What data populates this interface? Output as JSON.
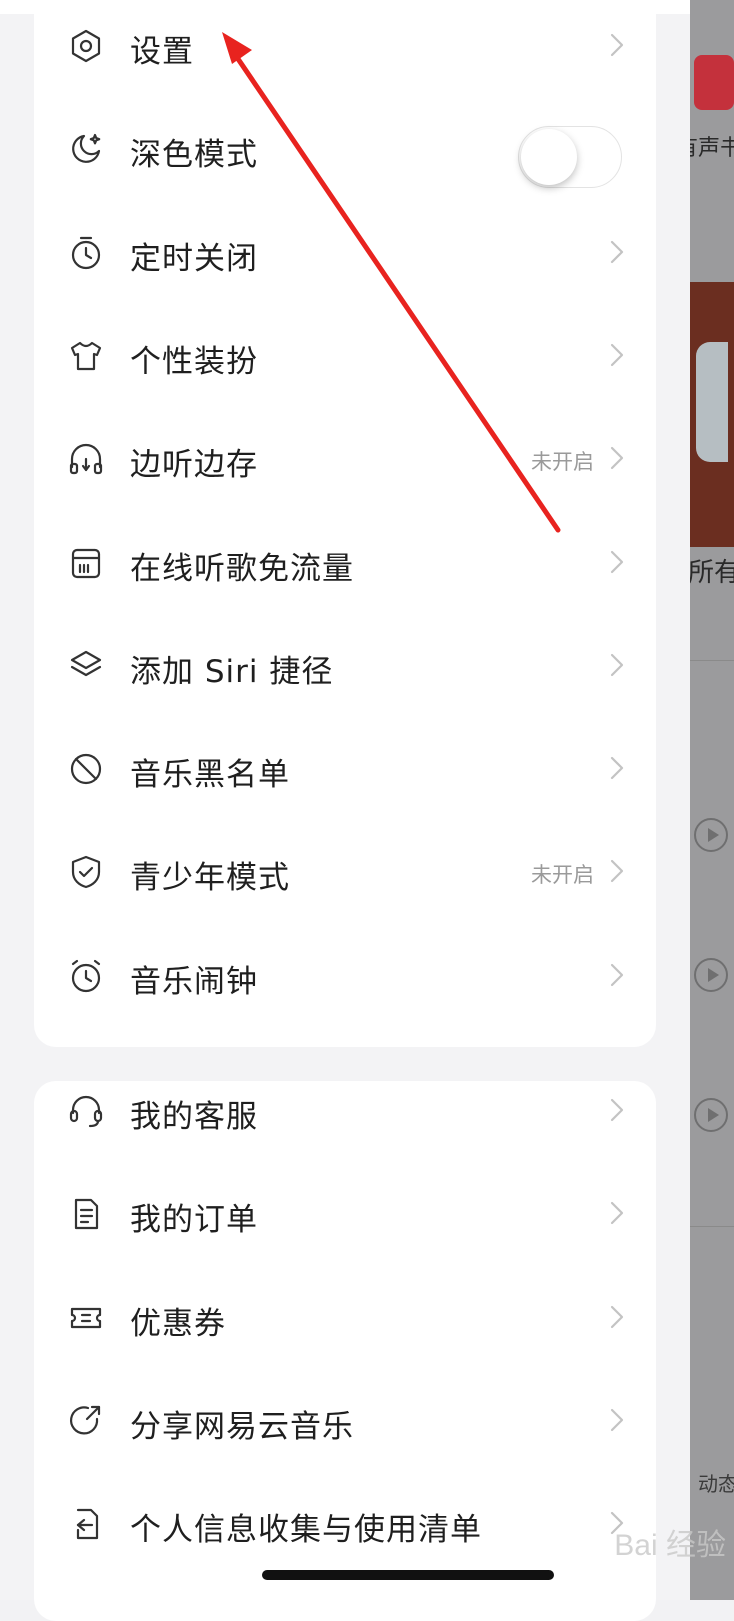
{
  "menu_group_1": [
    {
      "label": "设置",
      "icon": "gear-icon",
      "kind": "link"
    },
    {
      "label": "深色模式",
      "icon": "moon-icon",
      "kind": "toggle",
      "toggle_on": false
    },
    {
      "label": "定时关闭",
      "icon": "timer-icon",
      "kind": "link"
    },
    {
      "label": "个性装扮",
      "icon": "tshirt-icon",
      "kind": "link"
    },
    {
      "label": "边听边存",
      "icon": "headphones-download-icon",
      "kind": "link",
      "status": "未开启"
    },
    {
      "label": "在线听歌免流量",
      "icon": "sim-card-icon",
      "kind": "link"
    },
    {
      "label": "添加 Siri 捷径",
      "icon": "layers-icon",
      "kind": "link"
    },
    {
      "label": "音乐黑名单",
      "icon": "block-icon",
      "kind": "link"
    },
    {
      "label": "青少年模式",
      "icon": "shield-check-icon",
      "kind": "link",
      "status": "未开启"
    },
    {
      "label": "音乐闹钟",
      "icon": "alarm-clock-icon",
      "kind": "link"
    }
  ],
  "menu_group_2": [
    {
      "label": "我的客服",
      "icon": "headset-icon",
      "kind": "link"
    },
    {
      "label": "我的订单",
      "icon": "document-icon",
      "kind": "link"
    },
    {
      "label": "优惠券",
      "icon": "ticket-icon",
      "kind": "link"
    },
    {
      "label": "分享网易云音乐",
      "icon": "share-icon",
      "kind": "link"
    },
    {
      "label": "个人信息收集与使用清单",
      "icon": "file-arrow-icon",
      "kind": "link"
    }
  ],
  "background": {
    "texts": [
      "有声书",
      "所有",
      "动态"
    ]
  },
  "watermark": "Bai 经验",
  "colors": {
    "accent": "#c4313c",
    "arrow": "#e8231f",
    "text": "#1f1f1f",
    "status": "#9a9a9a"
  }
}
